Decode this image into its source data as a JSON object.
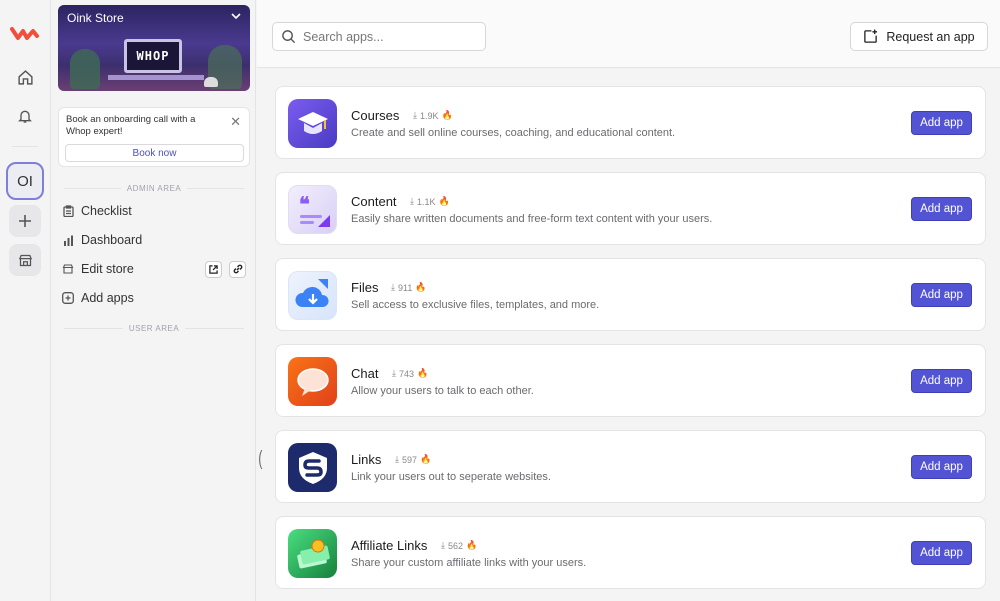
{
  "rail": {
    "store_initials": "OI",
    "brand_color": "#f24e3c"
  },
  "sidebar": {
    "store_name": "Oink Store",
    "banner_monitor_text": "WHOP",
    "onboarding": {
      "text": "Book an onboarding call with a Whop expert!",
      "button": "Book now"
    },
    "admin_section": "ADMIN AREA",
    "user_section": "USER AREA",
    "items": [
      {
        "label": "Checklist",
        "icon": "clipboard-icon"
      },
      {
        "label": "Dashboard",
        "icon": "bar-chart-icon"
      },
      {
        "label": "Edit store",
        "icon": "storefront-icon"
      },
      {
        "label": "Add apps",
        "icon": "plus-square-icon"
      }
    ]
  },
  "topbar": {
    "search_placeholder": "Search apps...",
    "request_label": "Request an app"
  },
  "apps": [
    {
      "name": "Courses",
      "installs": "1.9K",
      "desc": "Create and sell online courses, coaching, and educational content.",
      "button": "Add app",
      "icon": "graduation-cap-icon",
      "color": "#5b45d6"
    },
    {
      "name": "Content",
      "installs": "1.1K",
      "desc": "Easily share written documents and free-form text content with your users.",
      "button": "Add app",
      "icon": "quote-document-icon",
      "color": "#9a6ad9"
    },
    {
      "name": "Files",
      "installs": "911",
      "desc": "Sell access to exclusive files, templates, and more.",
      "button": "Add app",
      "icon": "cloud-download-icon",
      "color": "#3b82e6"
    },
    {
      "name": "Chat",
      "installs": "743",
      "desc": "Allow your users to talk to each other.",
      "button": "Add app",
      "icon": "speech-bubble-icon",
      "color": "#f05a22"
    },
    {
      "name": "Links",
      "installs": "597",
      "desc": "Link your users out to seperate websites.",
      "button": "Add app",
      "icon": "shield-link-icon",
      "color": "#1d2a6b"
    },
    {
      "name": "Affiliate Links",
      "installs": "562",
      "desc": "Share your custom affiliate links with your users.",
      "button": "Add app",
      "icon": "money-stack-icon",
      "color": "#2fa14f"
    }
  ]
}
